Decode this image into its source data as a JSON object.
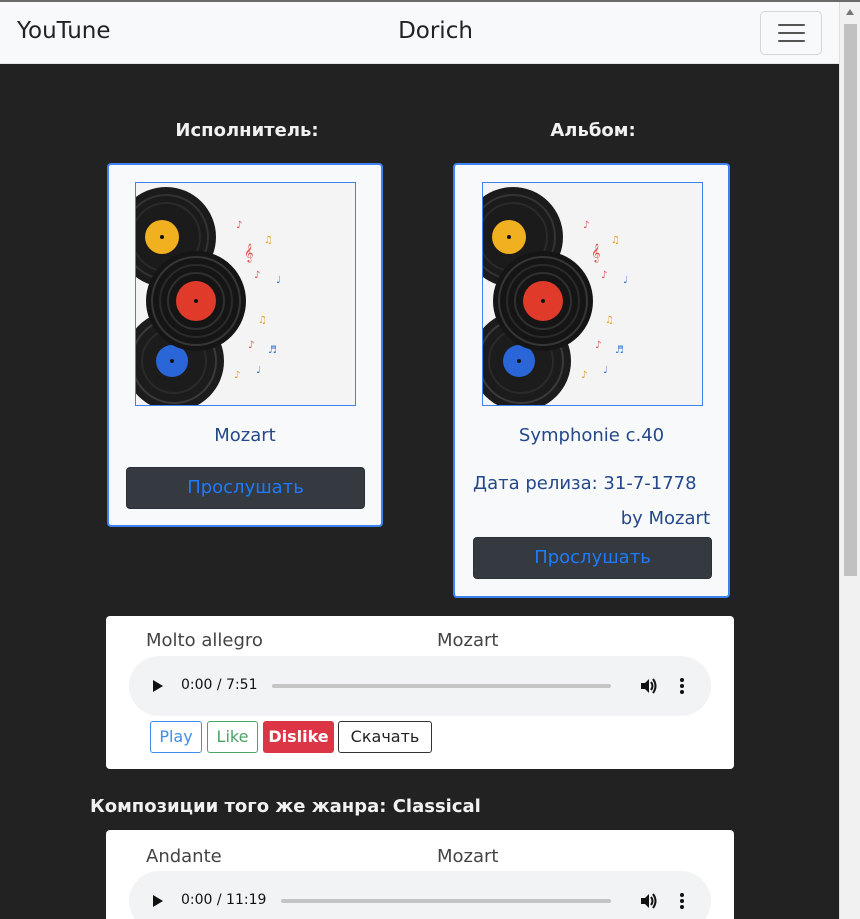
{
  "navbar": {
    "brand": "YouTune",
    "user": "Dorich",
    "menu_icon": "hamburger-icon"
  },
  "artist_card": {
    "heading": "Исполнитель:",
    "name": "Mozart",
    "listen_label": "Прослушать"
  },
  "album_card": {
    "heading": "Альбом:",
    "title": "Symphonie c.40",
    "release": "Дата релиза: 31-7-1778",
    "by": "by Mozart",
    "listen_label": "Прослушать"
  },
  "current_track": {
    "name": "Molto allegro",
    "artist": "Mozart",
    "time": "0:00 / 7:51",
    "buttons": {
      "play": "Play",
      "like": "Like",
      "dislike": "Dislike",
      "download": "Скачать"
    }
  },
  "genre_section": {
    "heading": "Композиции того же жанра: Classical",
    "tracks": [
      {
        "name": "Andante",
        "artist": "Mozart",
        "time": "0:00 / 11:19"
      }
    ]
  },
  "colors": {
    "accent": "#3c82f0",
    "dark": "#222222",
    "danger": "#dc3545",
    "success": "#4aa464"
  }
}
